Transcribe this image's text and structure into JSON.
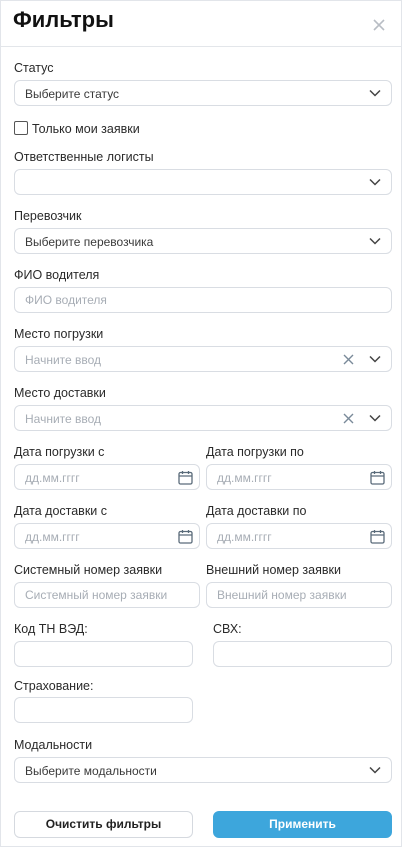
{
  "header": {
    "title": "Фильтры",
    "close_icon": "close-icon"
  },
  "status": {
    "label": "Статус",
    "placeholder": "Выберите статус"
  },
  "only_my": {
    "label": "Только мои заявки",
    "checked": false
  },
  "logists": {
    "label": "Ответственные логисты",
    "value": ""
  },
  "carrier": {
    "label": "Перевозчик",
    "placeholder": "Выберите перевозчика"
  },
  "driver": {
    "label": "ФИО водителя",
    "placeholder": "ФИО водителя"
  },
  "loading_place": {
    "label": "Место погрузки",
    "placeholder": "Начните ввод"
  },
  "delivery_place": {
    "label": "Место доставки",
    "placeholder": "Начните ввод"
  },
  "loading_date_from": {
    "label": "Дата погрузки с",
    "placeholder": "дд.мм.гггг"
  },
  "loading_date_to": {
    "label": "Дата погрузки по",
    "placeholder": "дд.мм.гггг"
  },
  "delivery_date_from": {
    "label": "Дата доставки с",
    "placeholder": "дд.мм.гггг"
  },
  "delivery_date_to": {
    "label": "Дата доставки по",
    "placeholder": "дд.мм.гггг"
  },
  "system_number": {
    "label": "Системный номер заявки",
    "placeholder": "Системный номер заявки"
  },
  "external_number": {
    "label": "Внешний номер заявки",
    "placeholder": "Внешний номер заявки"
  },
  "tn_ved": {
    "label": "Код ТН ВЭД:",
    "value": ""
  },
  "svh": {
    "label": "СВХ:",
    "value": ""
  },
  "insurance": {
    "label": "Страхование:",
    "value": ""
  },
  "modality": {
    "label": "Модальности",
    "placeholder": "Выберите модальности"
  },
  "actions": {
    "clear_label": "Очистить фильтры",
    "apply_label": "Применить"
  },
  "colors": {
    "accent": "#3da6dc",
    "border": "#d9dde3",
    "placeholder": "#a7adb5",
    "icon": "#5a6b7a"
  }
}
